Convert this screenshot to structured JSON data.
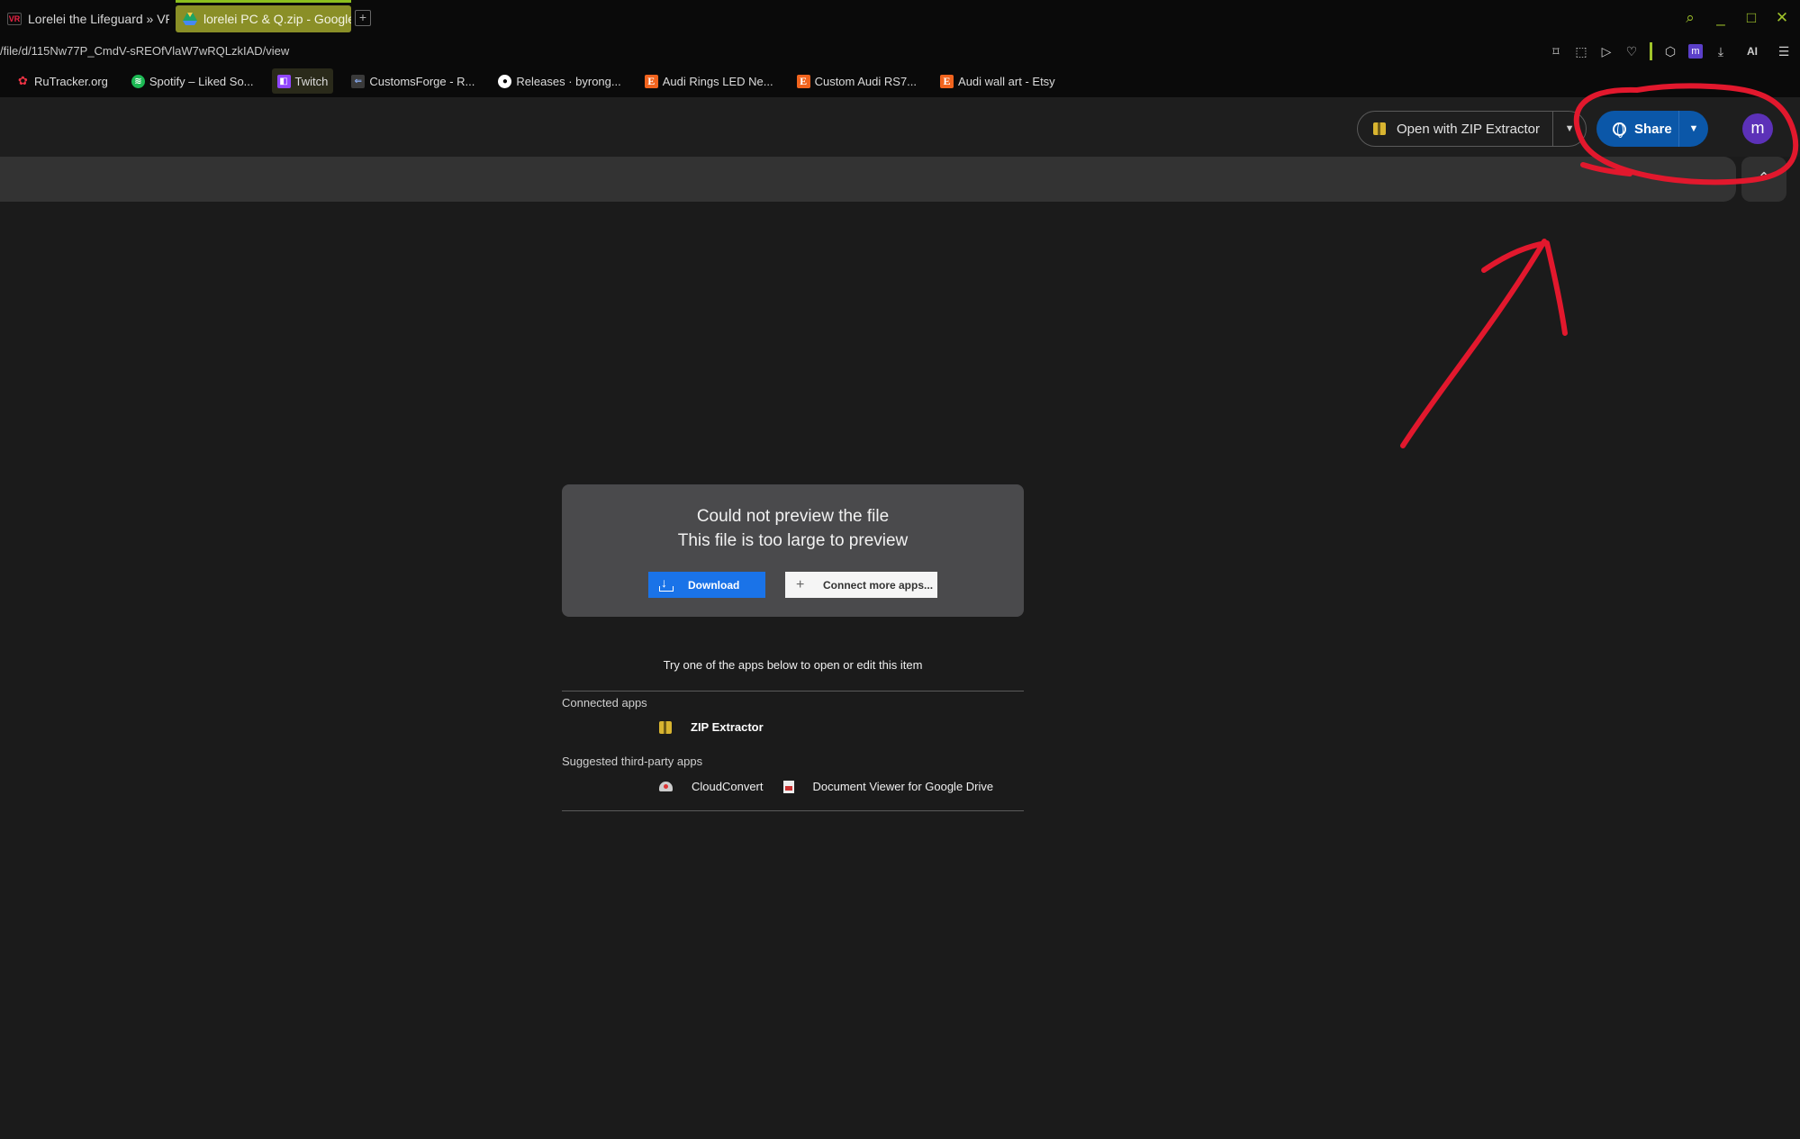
{
  "browser": {
    "tabs": [
      {
        "title": "Lorelei the Lifeguard » VR..."
      },
      {
        "title": "lorelei PC & Q.zip - Google",
        "active": true
      }
    ],
    "new_tab_symbol": "+",
    "url": "/file/d/115Nw77P_CmdV-sREOfVlaW7wRQLzkIAD/view",
    "tool_m_label": "m",
    "tool_ai_label": "AI",
    "accent_color": "#9fc32a"
  },
  "bookmarks": [
    {
      "label": "RuTracker.org",
      "icon": "rutracker-icon"
    },
    {
      "label": "Spotify – Liked So...",
      "icon": "spotify-icon"
    },
    {
      "label": "Twitch",
      "icon": "twitch-icon"
    },
    {
      "label": "CustomsForge - R...",
      "icon": "customsforge-icon"
    },
    {
      "label": "Releases · byrong...",
      "icon": "github-icon"
    },
    {
      "label": "Audi Rings LED Ne...",
      "icon": "etsy-icon",
      "icon_text": "E"
    },
    {
      "label": "Custom Audi RS7...",
      "icon": "etsy-icon",
      "icon_text": "E"
    },
    {
      "label": "Audi wall art - Etsy",
      "icon": "etsy-icon",
      "icon_text": "E"
    }
  ],
  "toolbar": {
    "open_with_label": "Open with ZIP Extractor",
    "share_label": "Share",
    "avatar_letter": "m",
    "share_color": "#0b57a8"
  },
  "preview": {
    "title_line1": "Could not preview the file",
    "title_line2": "This file is too large to preview",
    "download_label": "Download",
    "connect_label": "Connect more apps...",
    "download_color": "#1a73e8"
  },
  "apps": {
    "prompt": "Try one of the apps below to open or edit this item",
    "connected_label": "Connected apps",
    "connected": [
      {
        "name": "ZIP Extractor",
        "icon": "zip-extractor-icon"
      }
    ],
    "suggested_label": "Suggested third-party apps",
    "suggested": [
      {
        "name": "CloudConvert",
        "icon": "cloudconvert-icon"
      },
      {
        "name": "Document Viewer for Google Drive",
        "icon": "document-viewer-icon"
      }
    ]
  },
  "annotation": {
    "color": "#e2182d",
    "description_shapes": [
      "circle around share button",
      "arrow pointing to share button"
    ]
  }
}
